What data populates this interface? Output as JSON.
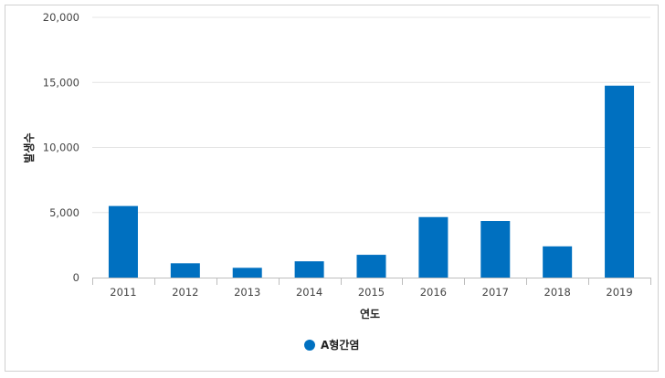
{
  "chart_data": {
    "type": "bar",
    "categories": [
      "2011",
      "2012",
      "2013",
      "2014",
      "2015",
      "2016",
      "2017",
      "2018",
      "2019"
    ],
    "series": [
      {
        "name": "A형간염",
        "values": [
          5500,
          1100,
          750,
          1250,
          1750,
          4650,
          4350,
          2400,
          14750
        ],
        "color": "#0070c0"
      }
    ],
    "xlabel": "연도",
    "ylabel": "발생수",
    "ylim": [
      0,
      20000
    ],
    "yticks": [
      0,
      5000,
      10000,
      15000,
      20000
    ],
    "ytick_labels": [
      "0",
      "5,000",
      "10,000",
      "15,000",
      "20,000"
    ],
    "grid": true,
    "legend_position": "bottom-center"
  }
}
